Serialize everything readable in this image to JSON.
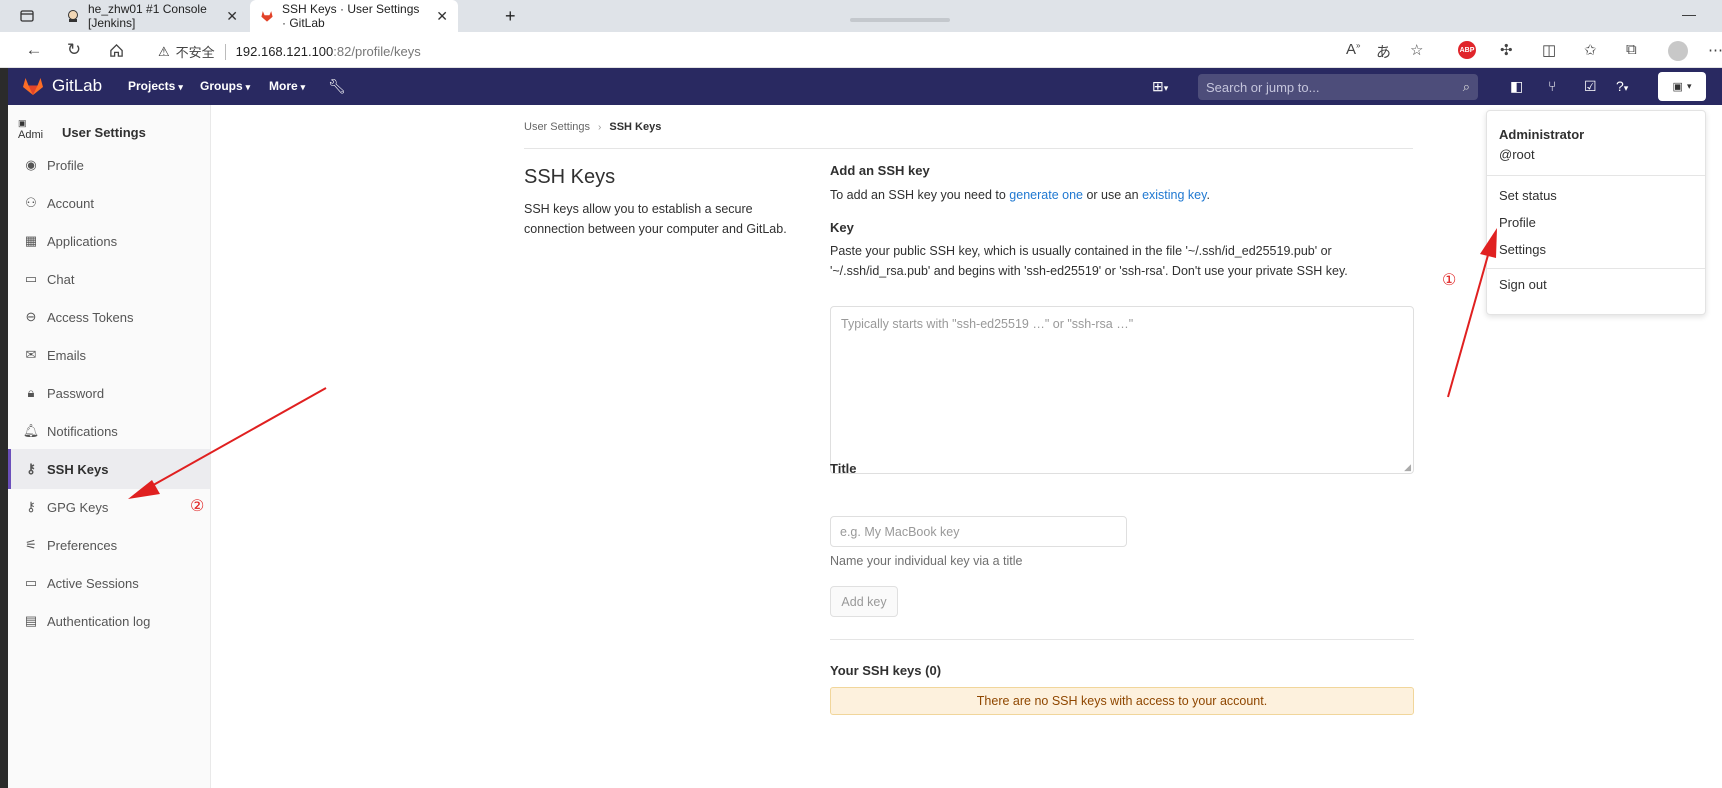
{
  "browser": {
    "tabs": [
      {
        "label": "he_zhw01 #1 Console [Jenkins]",
        "active": false
      },
      {
        "label": "SSH Keys · User Settings · GitLab",
        "active": true
      }
    ],
    "new_tab_icon": "plus-icon",
    "url_security": "不安全",
    "url_host": "192.168.121.100",
    "url_port": ":82",
    "url_path": "/profile/keys"
  },
  "header": {
    "brand": "GitLab",
    "nav": [
      "Projects",
      "Groups",
      "More"
    ],
    "search_placeholder": "Search or jump to..."
  },
  "sidebar": {
    "avatar_alt": "Admi",
    "title": "User Settings",
    "items": [
      {
        "label": "Profile",
        "icon": "profile-icon"
      },
      {
        "label": "Account",
        "icon": "account-icon"
      },
      {
        "label": "Applications",
        "icon": "applications-icon"
      },
      {
        "label": "Chat",
        "icon": "chat-icon"
      },
      {
        "label": "Access Tokens",
        "icon": "token-icon"
      },
      {
        "label": "Emails",
        "icon": "mail-icon"
      },
      {
        "label": "Password",
        "icon": "lock-icon"
      },
      {
        "label": "Notifications",
        "icon": "bell-icon"
      },
      {
        "label": "SSH Keys",
        "icon": "key-icon",
        "active": true
      },
      {
        "label": "GPG Keys",
        "icon": "key-icon"
      },
      {
        "label": "Preferences",
        "icon": "preferences-icon"
      },
      {
        "label": "Active Sessions",
        "icon": "monitor-icon"
      },
      {
        "label": "Authentication log",
        "icon": "log-icon"
      }
    ]
  },
  "breadcrumb": {
    "parent": "User Settings",
    "current": "SSH Keys"
  },
  "page": {
    "title": "SSH Keys",
    "description": "SSH keys allow you to establish a secure connection between your computer and GitLab."
  },
  "form": {
    "heading": "Add an SSH key",
    "intro_before": "To add an SSH key you need to ",
    "intro_link1": "generate one",
    "intro_mid": " or use an ",
    "intro_link2": "existing key",
    "intro_after": ".",
    "key_label": "Key",
    "key_help": "Paste your public SSH key, which is usually contained in the file '~/.ssh/id_ed25519.pub' or '~/.ssh/id_rsa.pub' and begins with 'ssh-ed25519' or 'ssh-rsa'. Don't use your private SSH key.",
    "key_placeholder": "Typically starts with \"ssh-ed25519 …\" or \"ssh-rsa …\"",
    "title_label": "Title",
    "title_placeholder": "e.g. My MacBook key",
    "title_hint": "Name your individual key via a title",
    "add_button": "Add key",
    "your_keys": "Your SSH keys (0)",
    "empty_notice": "There are no SSH keys with access to your account."
  },
  "dropdown": {
    "name": "Administrator",
    "username": "@root",
    "items": [
      "Set status",
      "Profile",
      "Settings",
      "Sign out"
    ]
  },
  "annotations": {
    "mark1": "①",
    "mark2": "②",
    "color": "#e02020"
  }
}
